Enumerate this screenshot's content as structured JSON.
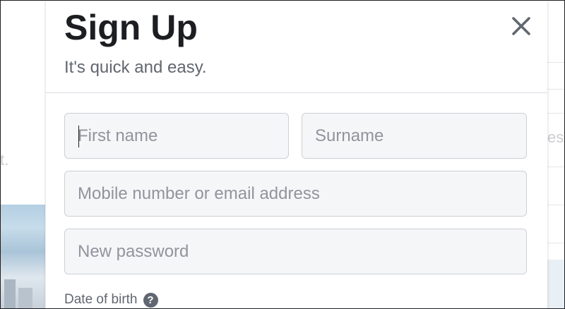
{
  "background": {
    "left_text": "t.",
    "right_text": "ess"
  },
  "modal": {
    "title": "Sign Up",
    "subtitle": "It's quick and easy.",
    "close_icon": "close-icon"
  },
  "form": {
    "first_name": {
      "value": "",
      "placeholder": "First name"
    },
    "surname": {
      "value": "",
      "placeholder": "Surname"
    },
    "contact": {
      "value": "",
      "placeholder": "Mobile number or email address"
    },
    "password": {
      "value": "",
      "placeholder": "New password"
    },
    "dob_label": "Date of birth",
    "help_icon": "question-mark-icon",
    "help_glyph": "?"
  },
  "colors": {
    "title": "#1c1e21",
    "subtitle": "#606770",
    "field_bg": "#f5f6f7",
    "field_border": "#ccd0d5",
    "placeholder": "#90949c",
    "divider": "#dadde1"
  }
}
